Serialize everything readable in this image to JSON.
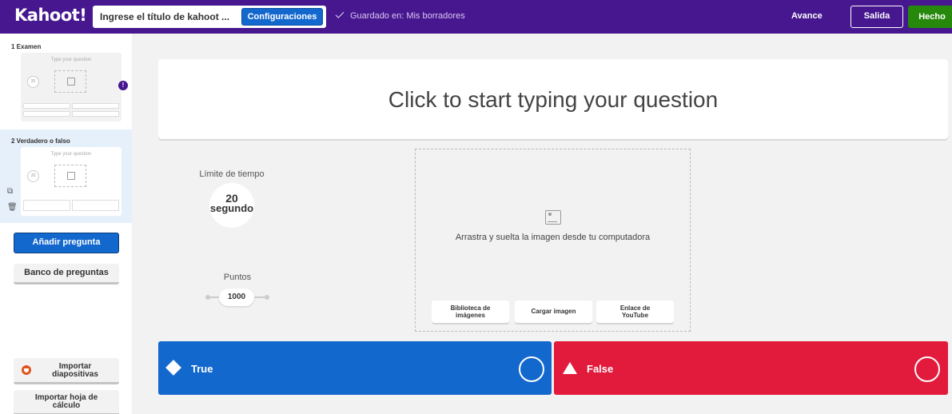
{
  "header": {
    "logo": "Kahoot!",
    "title_placeholder": "Ingrese el título de kahoot ...",
    "config_label": "Configuraciones",
    "saved_text": "Guardado en: Mis borradores",
    "preview_label": "Avance",
    "exit_label": "Salida",
    "done_label": "Hecho"
  },
  "sidebar": {
    "slides": [
      {
        "label": "1  Examen",
        "question_placeholder": "Type your question",
        "timer": "20"
      },
      {
        "label": "2  Verdadero o falso",
        "question_placeholder": "Type your question",
        "timer": "20"
      }
    ],
    "warning_glyph": "!",
    "add_question": "Añadir pregunta",
    "question_bank": "Banco de preguntas",
    "import_slides": "Importar\ndiapositivas",
    "import_sheet": "Importar hoja de\ncálculo"
  },
  "editor": {
    "question_placeholder": "Click to start typing your question",
    "time_limit_label": "Límite de tiempo",
    "time_limit_value": "20",
    "time_limit_unit": "segundo",
    "points_label": "Puntos",
    "points_value": "1000",
    "media_hint": "Arrastra y suelta la imagen desde tu computadora",
    "media_buttons": [
      "Biblioteca de\nimágenes",
      "Cargar imagen",
      "Enlace de\nYouTube"
    ],
    "answers": [
      {
        "text": "True",
        "color": "#1368ce",
        "shape": "diamond-icon"
      },
      {
        "text": "False",
        "color": "#e21b3c",
        "shape": "triangle-icon"
      }
    ]
  },
  "colors": {
    "brand_purple": "#46178f",
    "primary_blue": "#1368ce",
    "done_green": "#26890c"
  }
}
